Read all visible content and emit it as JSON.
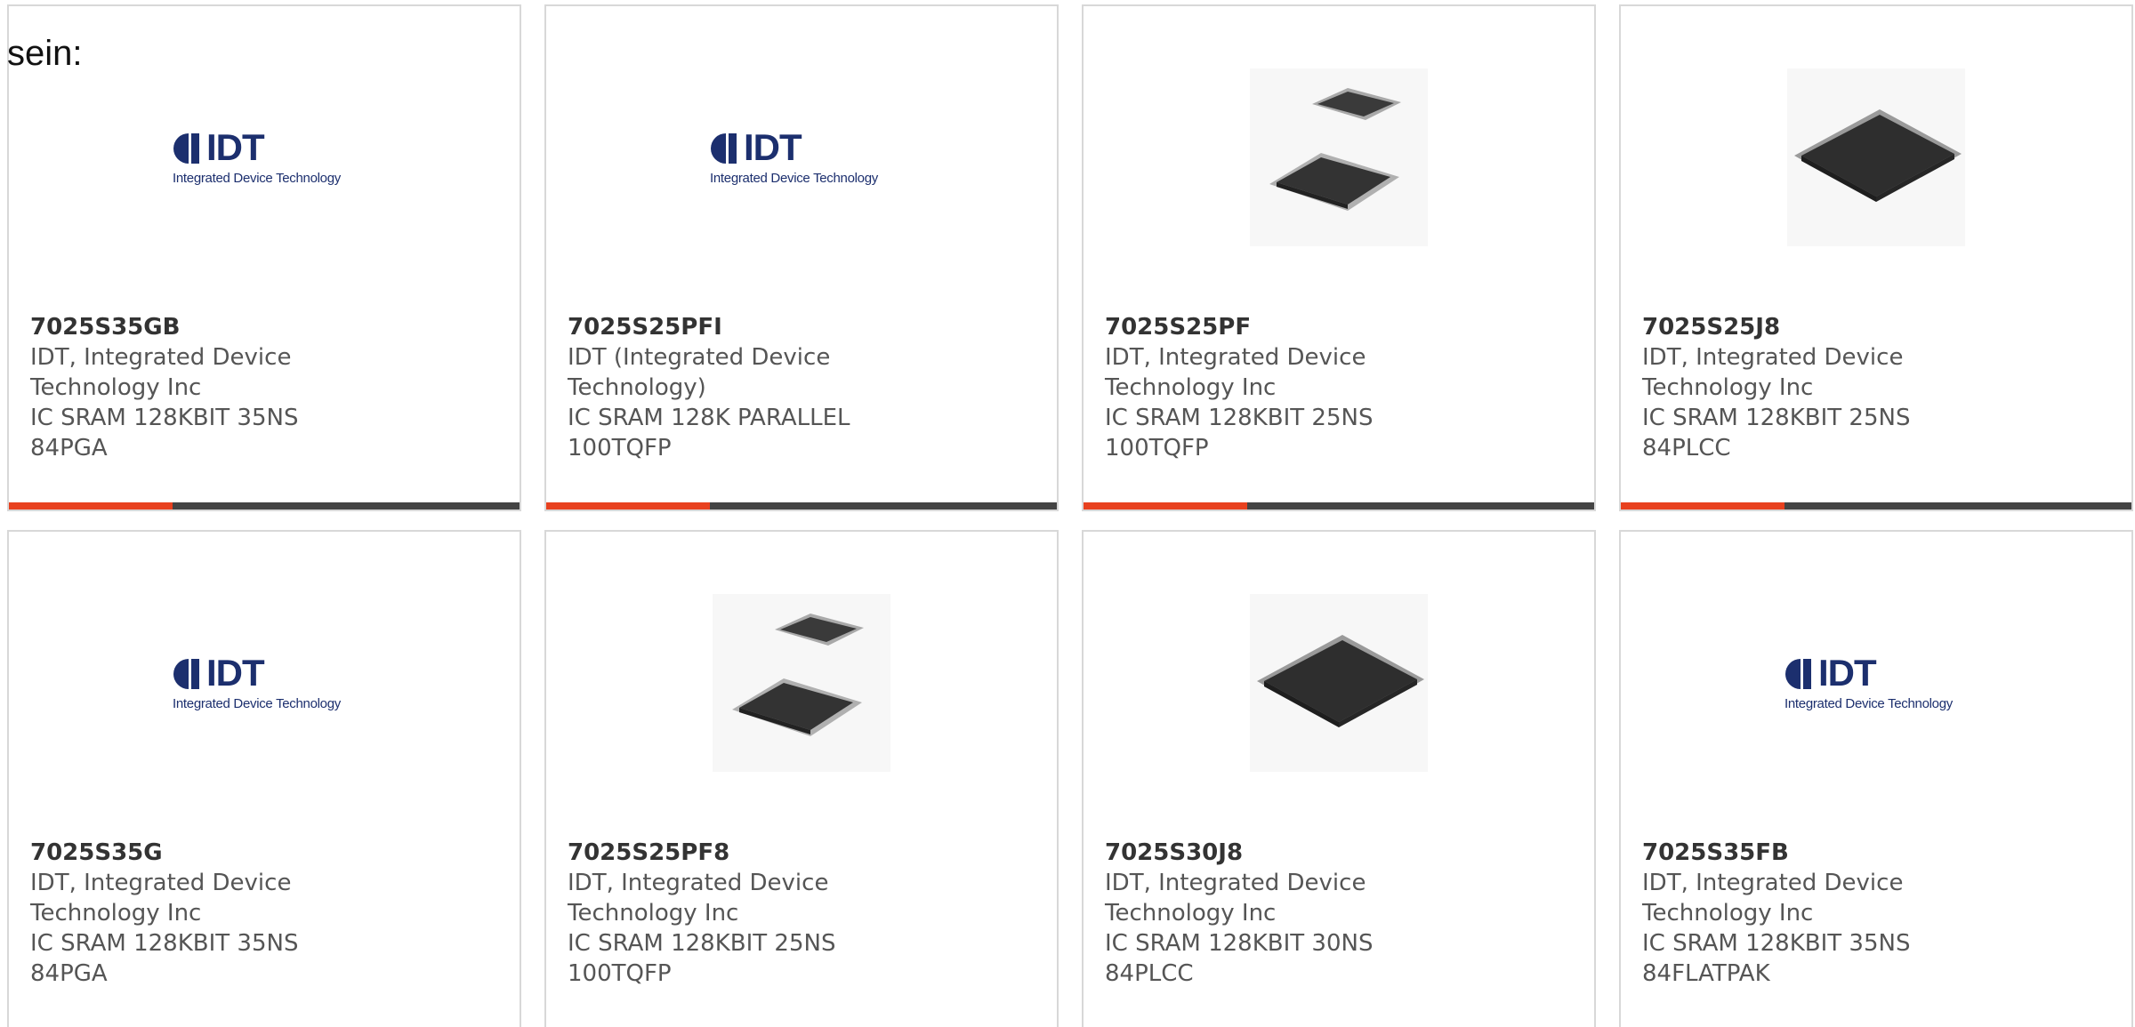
{
  "intro_text": "sein:",
  "colors": {
    "accent": "#e8411f",
    "bar": "#444444",
    "border": "#d8d8d8",
    "logo_blue": "#1c2f6e"
  },
  "products": [
    {
      "image": "idt-logo",
      "logo_text": "IDT",
      "logo_tagline": "Integrated Device Technology",
      "part_number": "7025S35GB",
      "manufacturer": "IDT, Integrated Device Technology Inc",
      "description": "IC SRAM 128KBIT 35NS 84PGA"
    },
    {
      "image": "idt-logo",
      "logo_text": "IDT",
      "logo_tagline": "Integrated Device Technology",
      "part_number": "7025S25PFI",
      "manufacturer": "IDT (Integrated Device Technology)",
      "description": "IC SRAM 128K PARALLEL 100TQFP"
    },
    {
      "image": "tqfp-chips-photo",
      "part_number": "7025S25PF",
      "manufacturer": "IDT, Integrated Device Technology Inc",
      "description": "IC SRAM 128KBIT 25NS 100TQFP"
    },
    {
      "image": "plcc-chip-photo",
      "part_number": "7025S25J8",
      "manufacturer": "IDT, Integrated Device Technology Inc",
      "description": "IC SRAM 128KBIT 25NS 84PLCC"
    },
    {
      "image": "idt-logo",
      "logo_text": "IDT",
      "logo_tagline": "Integrated Device Technology",
      "part_number": "7025S35G",
      "manufacturer": "IDT, Integrated Device Technology Inc",
      "description": "IC SRAM 128KBIT 35NS 84PGA"
    },
    {
      "image": "tqfp-chips-photo",
      "part_number": "7025S25PF8",
      "manufacturer": "IDT, Integrated Device Technology Inc",
      "description": "IC SRAM 128KBIT 25NS 100TQFP"
    },
    {
      "image": "plcc-chip-photo",
      "part_number": "7025S30J8",
      "manufacturer": "IDT, Integrated Device Technology Inc",
      "description": "IC SRAM 128KBIT 30NS 84PLCC"
    },
    {
      "image": "idt-logo",
      "logo_text": "IDT",
      "logo_tagline": "Integrated Device Technology",
      "part_number": "7025S35FB",
      "manufacturer": "IDT, Integrated Device Technology Inc",
      "description": "IC SRAM 128KBIT 35NS 84FLATPAK"
    }
  ]
}
